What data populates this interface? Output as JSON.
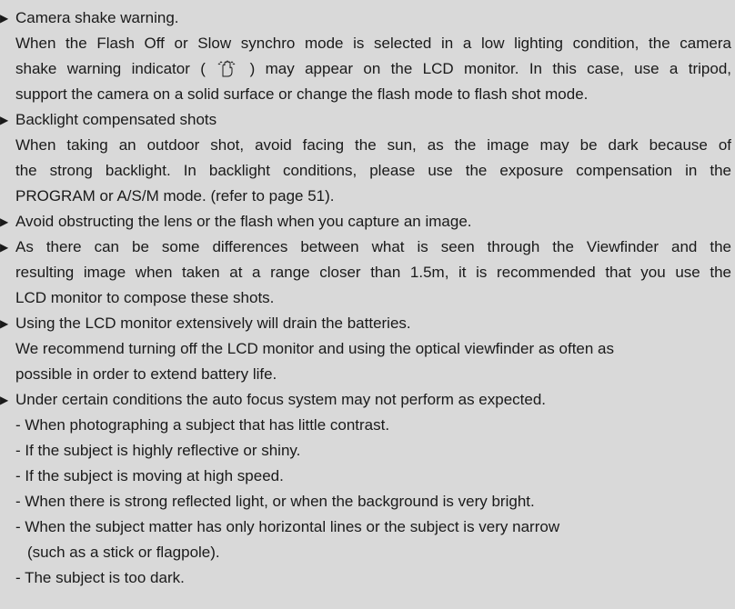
{
  "bullet_marker": "▶",
  "items": [
    {
      "heading": "Camera shake warning.",
      "body": [
        "When the Flash Off or Slow synchro mode is selected in a low lighting condition, the camera",
        {
          "before": "shake warning indicator ( ",
          "icon": "camera-shake-hand-icon",
          "after": " ) may appear on the LCD monitor. In this case, use a tripod,"
        },
        "support the camera on a solid surface or change the flash mode to flash shot mode."
      ]
    },
    {
      "heading": "Backlight compensated shots",
      "body": [
        "When taking an outdoor shot, avoid facing the sun, as the image may be dark because of",
        "the strong backlight. In backlight conditions, please use the exposure compensation in the",
        "PROGRAM or A/S/M mode. (refer to page 51)."
      ]
    },
    {
      "heading": "Avoid obstructing the lens or the flash when you capture an image.",
      "body": []
    },
    {
      "heading": "As there can be some differences between what is seen through the Viewfinder and the",
      "body": [
        "resulting image when taken at a range closer than 1.5m, it is recommended that you use the",
        "LCD monitor to compose these shots."
      ]
    },
    {
      "heading": "Using the LCD monitor extensively will drain the batteries.",
      "body": [
        "We recommend turning off the LCD monitor and using the optical viewfinder as often as",
        "possible in order to extend battery life."
      ]
    },
    {
      "heading": "Under certain conditions the auto focus system may not perform as expected.",
      "body": [],
      "subitems": [
        "- When photographing a subject that has little contrast.",
        "- If the subject is highly reflective or shiny.",
        "- If the subject is moving at high speed.",
        "- When there is strong reflected light, or when the background is very bright.",
        "- When the subject matter has only horizontal lines or the subject is very narrow",
        "(such as a stick or flagpole).",
        "- The subject is too dark."
      ]
    }
  ]
}
